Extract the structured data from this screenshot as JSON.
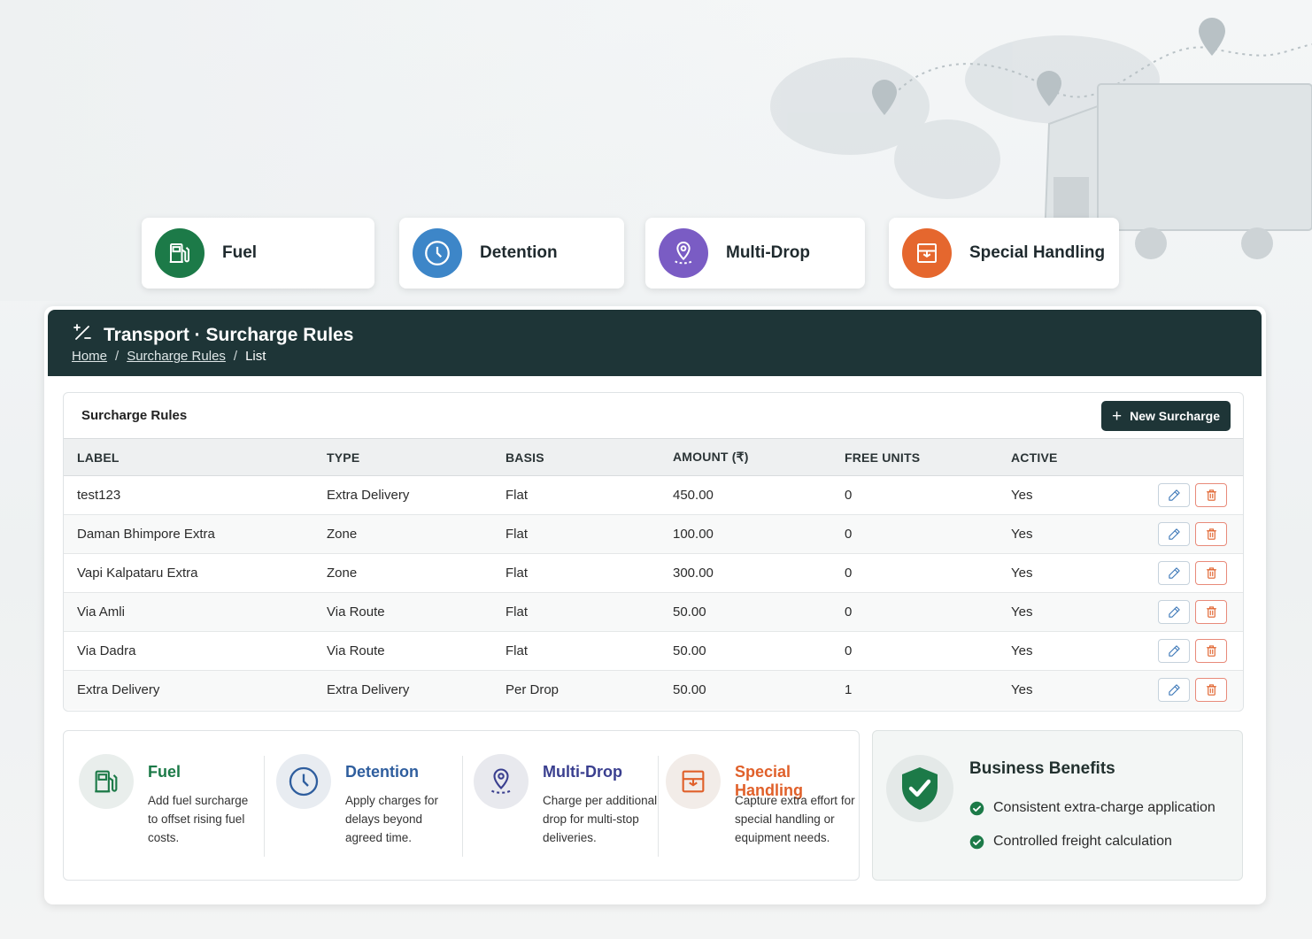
{
  "feature_cards": [
    {
      "label": "Fuel",
      "icon": "fuel-pump-icon",
      "color": "#1c7a48"
    },
    {
      "label": "Detention",
      "icon": "clock-icon",
      "color": "#3d86c8"
    },
    {
      "label": "Multi-Drop",
      "icon": "map-pin-route-icon",
      "color": "#7a5cc4"
    },
    {
      "label": "Special Handling",
      "icon": "box-handling-icon",
      "color": "#e5672e"
    }
  ],
  "header": {
    "title": "Transport · Surcharge Rules",
    "icon": "percent-icon",
    "breadcrumb": {
      "home": "Home",
      "section": "Surcharge Rules",
      "current": "List",
      "separator": "/"
    }
  },
  "table": {
    "title": "Surcharge Rules",
    "new_button": "New Surcharge",
    "columns": [
      "LABEL",
      "TYPE",
      "BASIS",
      "AMOUNT (₹)",
      "FREE UNITS",
      "ACTIVE"
    ],
    "rows": [
      {
        "label": "test123",
        "type": "Extra Delivery",
        "basis": "Flat",
        "amount": "450.00",
        "free_units": "0",
        "active": "Yes"
      },
      {
        "label": "Daman Bhimpore Extra",
        "type": "Zone",
        "basis": "Flat",
        "amount": "100.00",
        "free_units": "0",
        "active": "Yes"
      },
      {
        "label": "Vapi Kalpataru Extra",
        "type": "Zone",
        "basis": "Flat",
        "amount": "300.00",
        "free_units": "0",
        "active": "Yes"
      },
      {
        "label": "Via Amli",
        "type": "Via Route",
        "basis": "Flat",
        "amount": "50.00",
        "free_units": "0",
        "active": "Yes"
      },
      {
        "label": "Via Dadra",
        "type": "Via Route",
        "basis": "Flat",
        "amount": "50.00",
        "free_units": "0",
        "active": "Yes"
      },
      {
        "label": "Extra Delivery",
        "type": "Extra Delivery",
        "basis": "Per Drop",
        "amount": "50.00",
        "free_units": "1",
        "active": "Yes"
      }
    ]
  },
  "info": [
    {
      "title": "Fuel",
      "desc": "Add fuel surcharge to offset rising fuel costs.",
      "color": "#1c7a48",
      "icon": "fuel-pump-icon"
    },
    {
      "title": "Detention",
      "desc": "Apply charges for delays beyond agreed time.",
      "color": "#2f5e9e",
      "icon": "clock-icon"
    },
    {
      "title": "Multi-Drop",
      "desc": "Charge per additional drop for multi-stop deliveries.",
      "color": "#3a3f8f",
      "icon": "map-pin-route-icon"
    },
    {
      "title": "Special Handling",
      "desc": "Capture extra effort for special handling or equipment needs.",
      "color": "#e0602a",
      "icon": "box-handling-icon"
    }
  ],
  "benefits": {
    "title": "Business Benefits",
    "items": [
      "Consistent extra-charge application",
      "Controlled freight calculation"
    ],
    "color": "#1c7a48"
  }
}
